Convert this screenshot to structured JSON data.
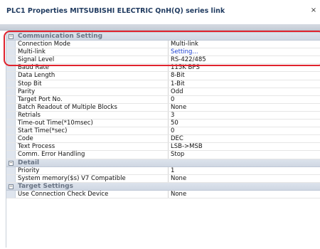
{
  "window": {
    "title": "PLC1 Properties MITSUBISHI ELECTRIC QnH(Q) series link",
    "close_glyph": "×"
  },
  "grid": {
    "categories": [
      {
        "label": "Communication Setting",
        "toggle": "−",
        "rows": [
          {
            "name": "Connection Mode",
            "value": "Multi-link"
          },
          {
            "name": "Multi-link",
            "value": "Setting...",
            "link": true
          },
          {
            "name": "Signal Level",
            "value": "RS-422/485"
          },
          {
            "name": "Baud Rate",
            "value": "115K BPS"
          },
          {
            "name": "Data Length",
            "value": "8-Bit"
          },
          {
            "name": "Stop Bit",
            "value": "1-Bit"
          },
          {
            "name": "Parity",
            "value": "Odd"
          },
          {
            "name": "Target Port No.",
            "value": "0"
          },
          {
            "name": "Batch Readout of Multiple Blocks",
            "value": "None"
          },
          {
            "name": "Retrials",
            "value": "3"
          },
          {
            "name": "Time-out Time(*10msec)",
            "value": "50"
          },
          {
            "name": "Start Time(*sec)",
            "value": "0"
          },
          {
            "name": "Code",
            "value": "DEC"
          },
          {
            "name": "Text Process",
            "value": "LSB->MSB"
          },
          {
            "name": "Comm. Error Handling",
            "value": "Stop"
          }
        ]
      },
      {
        "label": "Detail",
        "toggle": "−",
        "rows": [
          {
            "name": "Priority",
            "value": "1"
          },
          {
            "name": "System memory($s) V7 Compatible",
            "value": "None"
          }
        ]
      },
      {
        "label": "Target Settings",
        "toggle": "−",
        "rows": [
          {
            "name": "Use Connection Check Device",
            "value": "None"
          }
        ]
      }
    ]
  },
  "colors": {
    "highlight": "#e0232e",
    "link": "#1a3fd1",
    "category_text": "#6a7585"
  }
}
